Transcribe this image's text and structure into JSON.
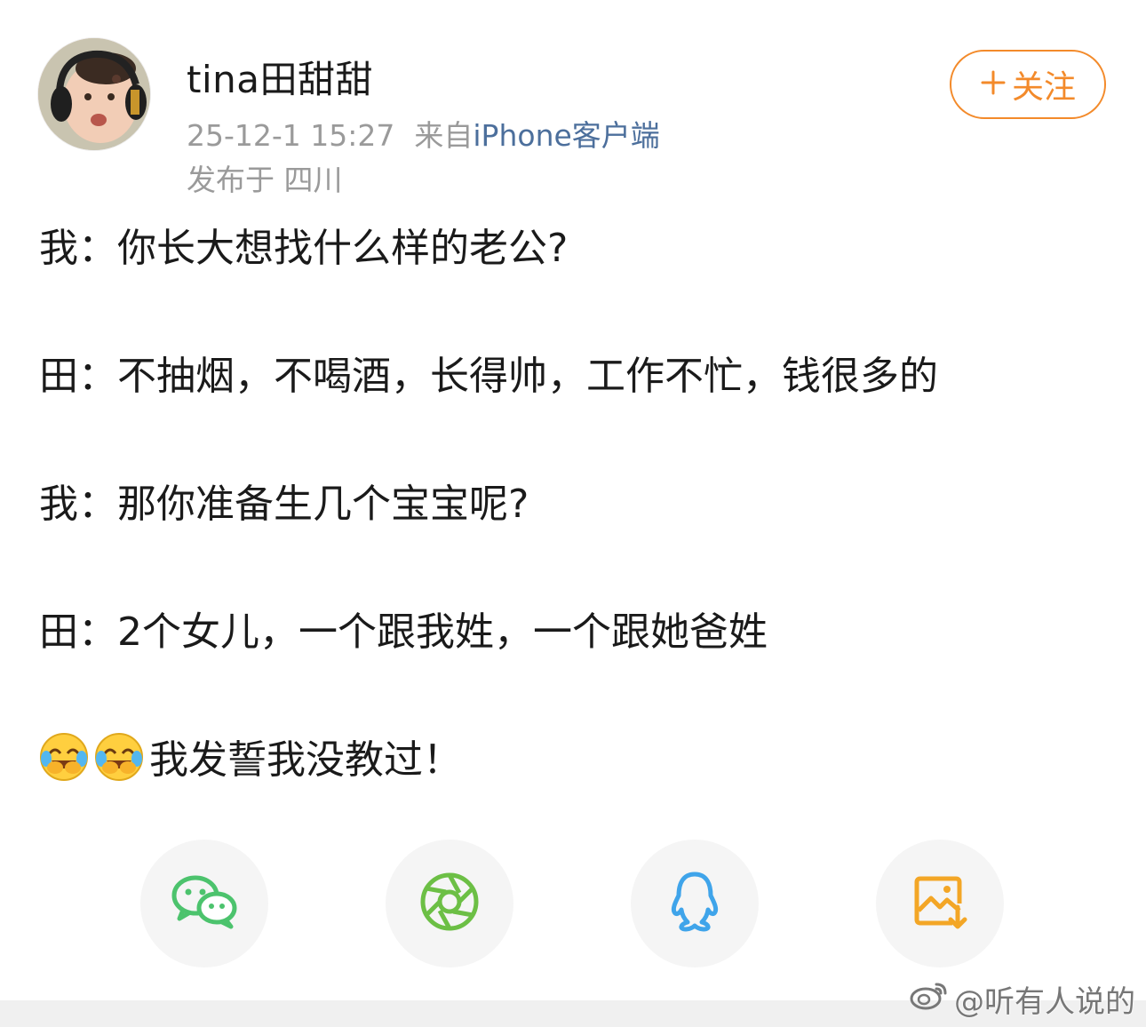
{
  "post": {
    "author": {
      "name": "tina田甜甜",
      "timestamp": "25-12-1 15:27",
      "source_prefix": "来自",
      "source": "iPhone客户端",
      "location": "发布于 四川"
    },
    "follow_label": "关注",
    "lines": [
      "我：你长大想找什么样的老公?",
      "田：不抽烟，不喝酒，长得帅，工作不忙，钱很多的",
      "我：那你准备生几个宝宝呢?",
      "田：2个女儿，一个跟我姓，一个跟她爸姓"
    ],
    "last_line": "我发誓我没教过！"
  },
  "share": {
    "items": [
      {
        "icon": "wechat-icon",
        "color": "#4cc36d"
      },
      {
        "icon": "moments-icon",
        "color": "#6cbf45"
      },
      {
        "icon": "qq-icon",
        "color": "#3fa4ea"
      },
      {
        "icon": "save-image-icon",
        "color": "#f3a626"
      }
    ]
  },
  "watermark": "@听有人说的",
  "colors": {
    "accent": "#f38a2a",
    "link": "#4c6f9c",
    "meta": "#9a9a9a"
  }
}
